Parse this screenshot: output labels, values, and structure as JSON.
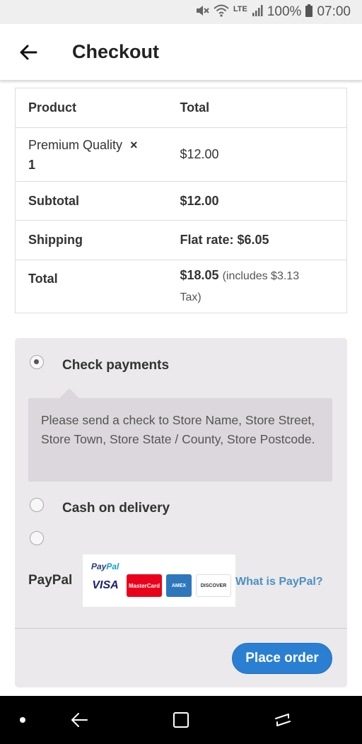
{
  "status_bar": {
    "lte": "LTE",
    "battery": "100%",
    "time": "07:00"
  },
  "header": {
    "title": "Checkout"
  },
  "order_table": {
    "head": {
      "product": "Product",
      "total": "Total"
    },
    "item": {
      "name": "Premium Quality",
      "qty_mark": "×",
      "qty": "1",
      "price": "$12.00"
    },
    "subtotal": {
      "label": "Subtotal",
      "value": "$12.00"
    },
    "shipping": {
      "label": "Shipping",
      "value": "Flat rate: $6.05"
    },
    "total": {
      "label": "Total",
      "value": "$18.05",
      "tax_note": "(includes $3.13",
      "tax_note_2": "Tax)"
    }
  },
  "payment": {
    "check": {
      "label": "Check payments",
      "selected": true,
      "description": "Please send a check to Store Name, Store Street, Store Town, Store State / County, Store Postcode."
    },
    "cod": {
      "label": "Cash on delivery",
      "selected": false
    },
    "paypal": {
      "label": "PayPal",
      "selected": false,
      "logo_text_1": "Pay",
      "logo_text_2": "Pal",
      "cards": [
        "VISA",
        "MasterCard",
        "AMEX",
        "DISCOVER"
      ],
      "what_link": "What is PayPal?"
    },
    "place_order": "Place order"
  },
  "colors": {
    "accent": "#2a7fd3",
    "link": "#4a90c2",
    "panel": "#ebe9eb",
    "notice": "#dcd7dc"
  }
}
